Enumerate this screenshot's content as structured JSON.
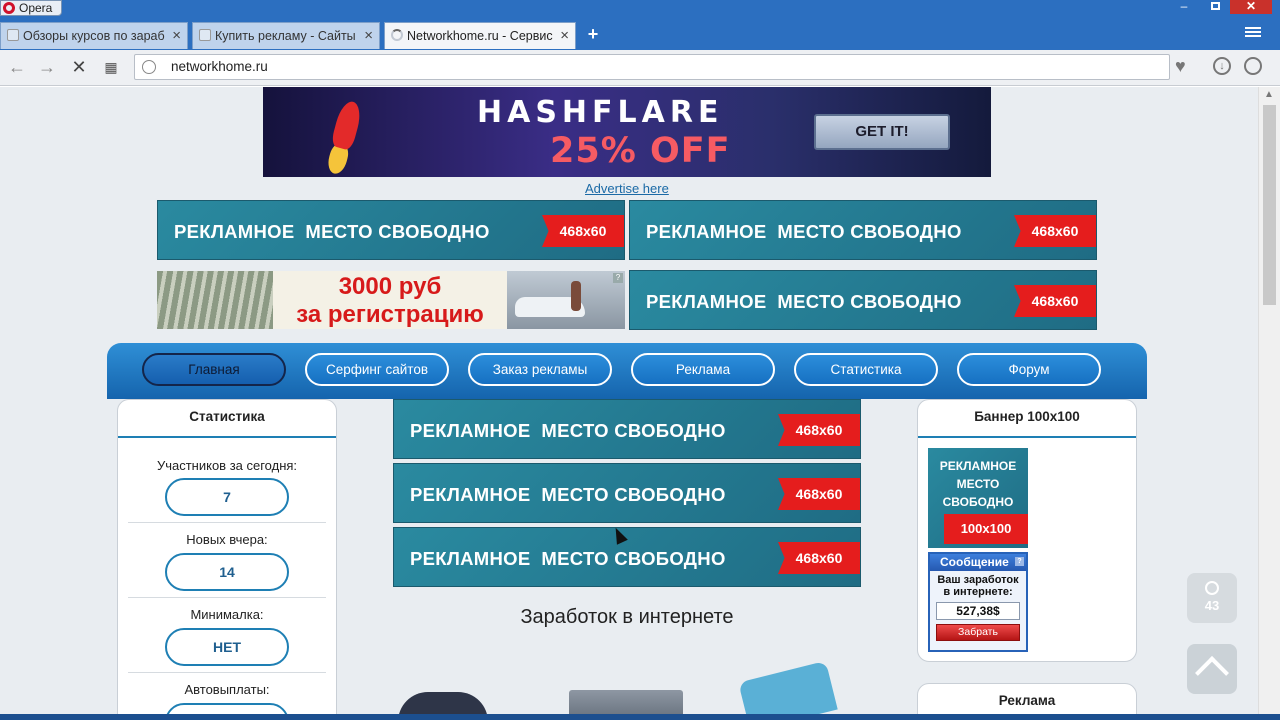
{
  "browser": {
    "app_name": "Opera",
    "window_controls": {
      "minimize": "–",
      "close": "✕"
    },
    "tabs": [
      {
        "label": "Обзоры курсов по зараб",
        "active": false
      },
      {
        "label": "Купить рекламу - Сайты",
        "active": false
      },
      {
        "label": "Networkhome.ru - Сервис",
        "active": true
      }
    ],
    "new_tab_label": "+",
    "url": "networkhome.ru",
    "icons": [
      "back-icon",
      "forward-icon",
      "stop-icon",
      "speed-dial-icon",
      "globe-icon",
      "heart-icon",
      "download-icon",
      "user-icon",
      "tab-menu-icon"
    ]
  },
  "top_banner": {
    "brand": "HASHFLARE",
    "offer": "25% OFF",
    "cta": "GET IT!"
  },
  "advertise_link": "Advertise here",
  "ad_slot": {
    "text": "РЕКЛАМНОЕ  МЕСТО СВОБОДНО",
    "size": "468x60"
  },
  "promo_banner": {
    "line1": "3000 руб",
    "line2": "за регистрацию",
    "q": "?"
  },
  "nav": {
    "items": [
      "Главная",
      "Серфинг сайтов",
      "Заказ рекламы",
      "Реклама",
      "Статистика",
      "Форум"
    ],
    "active_index": 0
  },
  "stats": {
    "title": "Статистика",
    "rows": [
      {
        "label": "Участников за сегодня:",
        "value": "7"
      },
      {
        "label": "Новых вчера:",
        "value": "14"
      },
      {
        "label": "Минималка:",
        "value": "НЕТ"
      },
      {
        "label": "Автовыплаты:",
        "value": ""
      }
    ]
  },
  "banner_box": {
    "title": "Баннер 100x100",
    "banner_text_1": "РЕКЛАМНОЕ",
    "banner_text_2": "МЕСТО",
    "banner_text_3": "СВОБОДНО",
    "banner_size": "100x100",
    "message": {
      "header": "Сообщение",
      "q": "?",
      "line1": "Ваш заработок",
      "line2": "в интернете:",
      "amount": "527,38$",
      "button": "Забрать"
    }
  },
  "ads_box": {
    "title": "Реклама"
  },
  "center": {
    "heading": "Заработок в интернете"
  },
  "floating": {
    "views_count": "43"
  },
  "colors": {
    "accent_blue": "#1e7fb4",
    "ad_teal": "#2a8aa0",
    "ad_red": "#e51d1d",
    "nav_blue": "#1564ad",
    "browser_blue": "#2c6fc0"
  }
}
